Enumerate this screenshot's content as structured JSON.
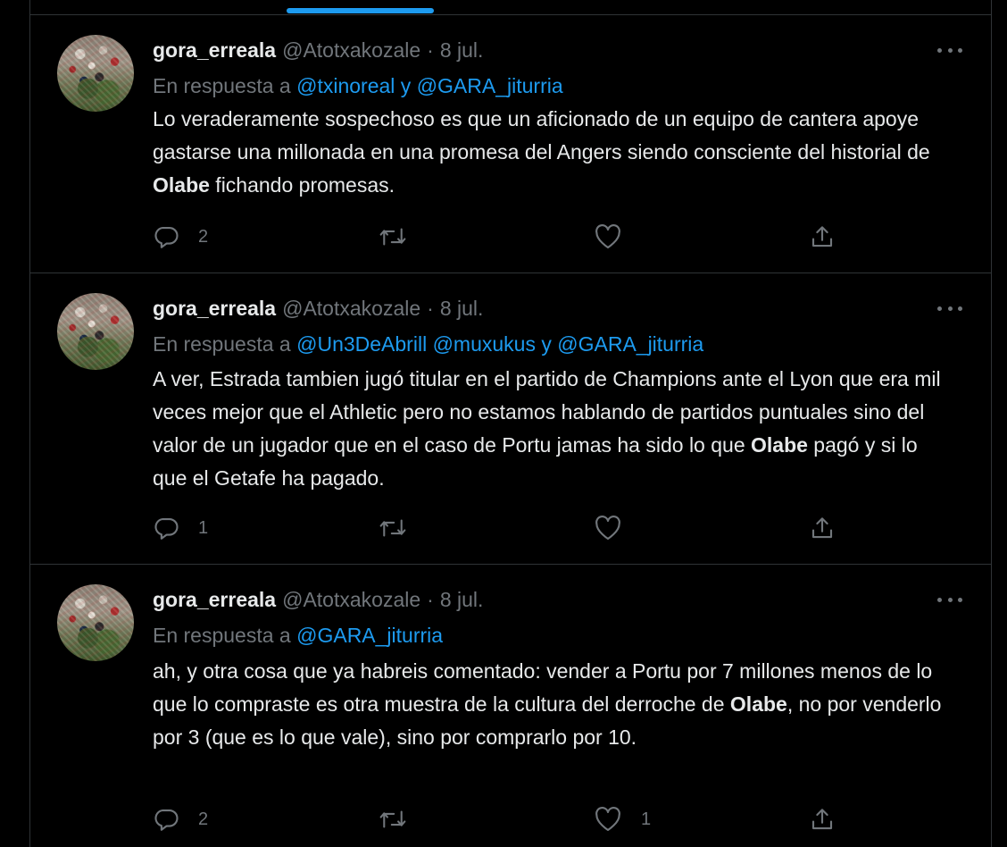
{
  "colors": {
    "background": "#000000",
    "text": "#e7e9ea",
    "muted": "#71767b",
    "link": "#1d9bf0",
    "divider": "#2f3336"
  },
  "icons": [
    "reply-icon",
    "retweet-icon",
    "like-icon",
    "share-icon",
    "more-icon"
  ],
  "tweets": [
    {
      "name": "gora_erreala",
      "handle": "@Atotxakozale",
      "dot": "·",
      "date": "8 jul.",
      "reply_prefix": "En respuesta a",
      "reply_mentions": [
        "@txinoreal",
        "y",
        "@GARA_jiturria"
      ],
      "text_parts": [
        "Lo veraderamente sospechoso es que un aficionado de un equipo de cantera apoye gastarse una millonada en una promesa del Angers siendo consciente del historial de ",
        "Olabe",
        " fichando promesas."
      ],
      "reply_count": "2",
      "retweet_count": "",
      "like_count": ""
    },
    {
      "name": "gora_erreala",
      "handle": "@Atotxakozale",
      "dot": "·",
      "date": "8 jul.",
      "reply_prefix": "En respuesta a",
      "reply_mentions": [
        "@Un3DeAbrill",
        "@muxukus",
        "y",
        "@GARA_jiturria"
      ],
      "text_parts": [
        "A ver, Estrada tambien jugó titular en el partido de Champions ante el Lyon que era mil veces mejor que el Athletic pero no estamos hablando de partidos puntuales sino del valor de un jugador que en el caso de Portu jamas ha sido lo que ",
        "Olabe",
        " pagó y si lo que el Getafe ha pagado."
      ],
      "reply_count": "1",
      "retweet_count": "",
      "like_count": ""
    },
    {
      "name": "gora_erreala",
      "handle": "@Atotxakozale",
      "dot": "·",
      "date": "8 jul.",
      "reply_prefix": "En respuesta a",
      "reply_mentions": [
        "@GARA_jiturria"
      ],
      "text_parts": [
        "ah, y otra cosa que ya habreis comentado: vender a Portu por 7 millones menos de lo que lo compraste es otra muestra de la cultura del derroche de ",
        "Olabe",
        ", no por venderlo por 3 (que es lo que vale), sino por comprarlo por 10."
      ],
      "reply_count": "2",
      "retweet_count": "",
      "like_count": "1"
    }
  ]
}
